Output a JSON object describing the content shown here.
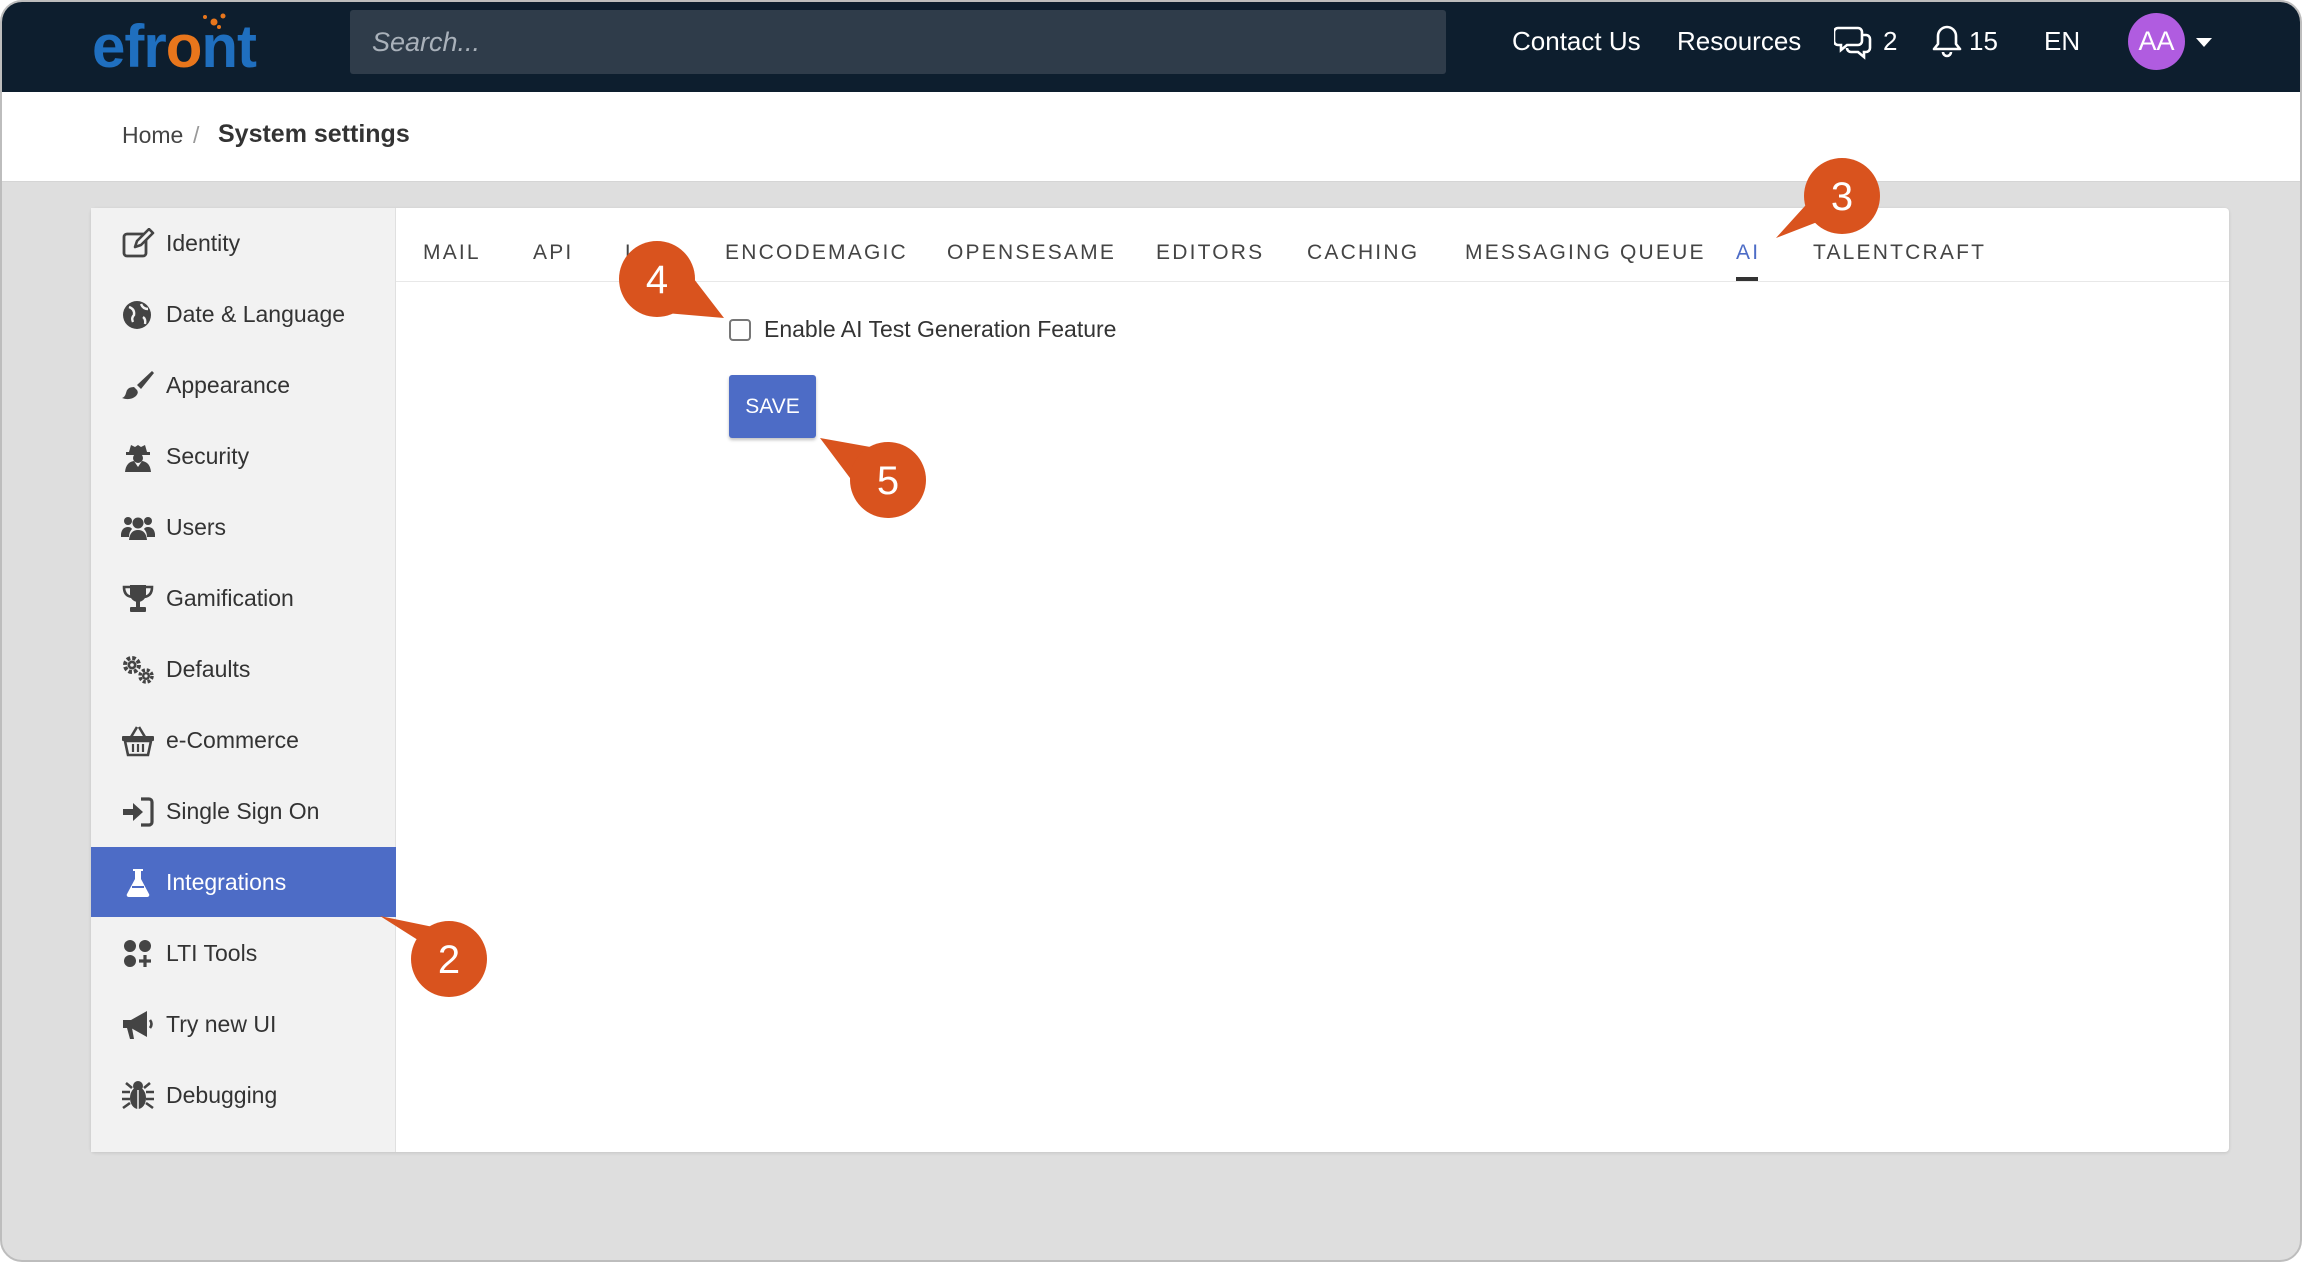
{
  "app": {
    "logo_text": "efront",
    "brand_color": "#1f6fbf",
    "brand_accent": "#e8761c"
  },
  "header": {
    "search_placeholder": "Search...",
    "contact_label": "Contact Us",
    "resources_label": "Resources",
    "messages_count": "2",
    "notifications_count": "15",
    "language": "EN",
    "avatar_initials": "AA"
  },
  "breadcrumb": {
    "home": "Home",
    "separator": "/",
    "current": "System settings"
  },
  "sidebar": {
    "active_color": "#4d6cc6",
    "items": [
      {
        "label": "Identity",
        "icon": "edit-icon"
      },
      {
        "label": "Date & Language",
        "icon": "globe-icon"
      },
      {
        "label": "Appearance",
        "icon": "brush-icon"
      },
      {
        "label": "Security",
        "icon": "user-secret-icon"
      },
      {
        "label": "Users",
        "icon": "users-icon"
      },
      {
        "label": "Gamification",
        "icon": "trophy-icon"
      },
      {
        "label": "Defaults",
        "icon": "gears-icon"
      },
      {
        "label": "e-Commerce",
        "icon": "basket-icon"
      },
      {
        "label": "Single Sign On",
        "icon": "sign-in-icon"
      },
      {
        "label": "Integrations",
        "icon": "flask-icon",
        "active": true
      },
      {
        "label": "LTI Tools",
        "icon": "grid-plus-icon"
      },
      {
        "label": "Try new UI",
        "icon": "megaphone-icon"
      },
      {
        "label": "Debugging",
        "icon": "bug-icon"
      }
    ]
  },
  "tabs": [
    {
      "label": "MAIL"
    },
    {
      "label": "API"
    },
    {
      "label": "L"
    },
    {
      "label": "ENCODEMAGIC"
    },
    {
      "label": "OPENSESAME"
    },
    {
      "label": "EDITORS"
    },
    {
      "label": "CACHING"
    },
    {
      "label": "MESSAGING QUEUE"
    },
    {
      "label": "AI",
      "active": true
    },
    {
      "label": "TALENTCRAFT"
    }
  ],
  "content": {
    "checkbox_label": "Enable AI Test Generation Feature",
    "checkbox_checked": false,
    "save_label": "SAVE"
  },
  "callouts": {
    "color": "#d9531e",
    "items": [
      {
        "number": "2"
      },
      {
        "number": "3"
      },
      {
        "number": "4"
      },
      {
        "number": "5"
      }
    ]
  }
}
